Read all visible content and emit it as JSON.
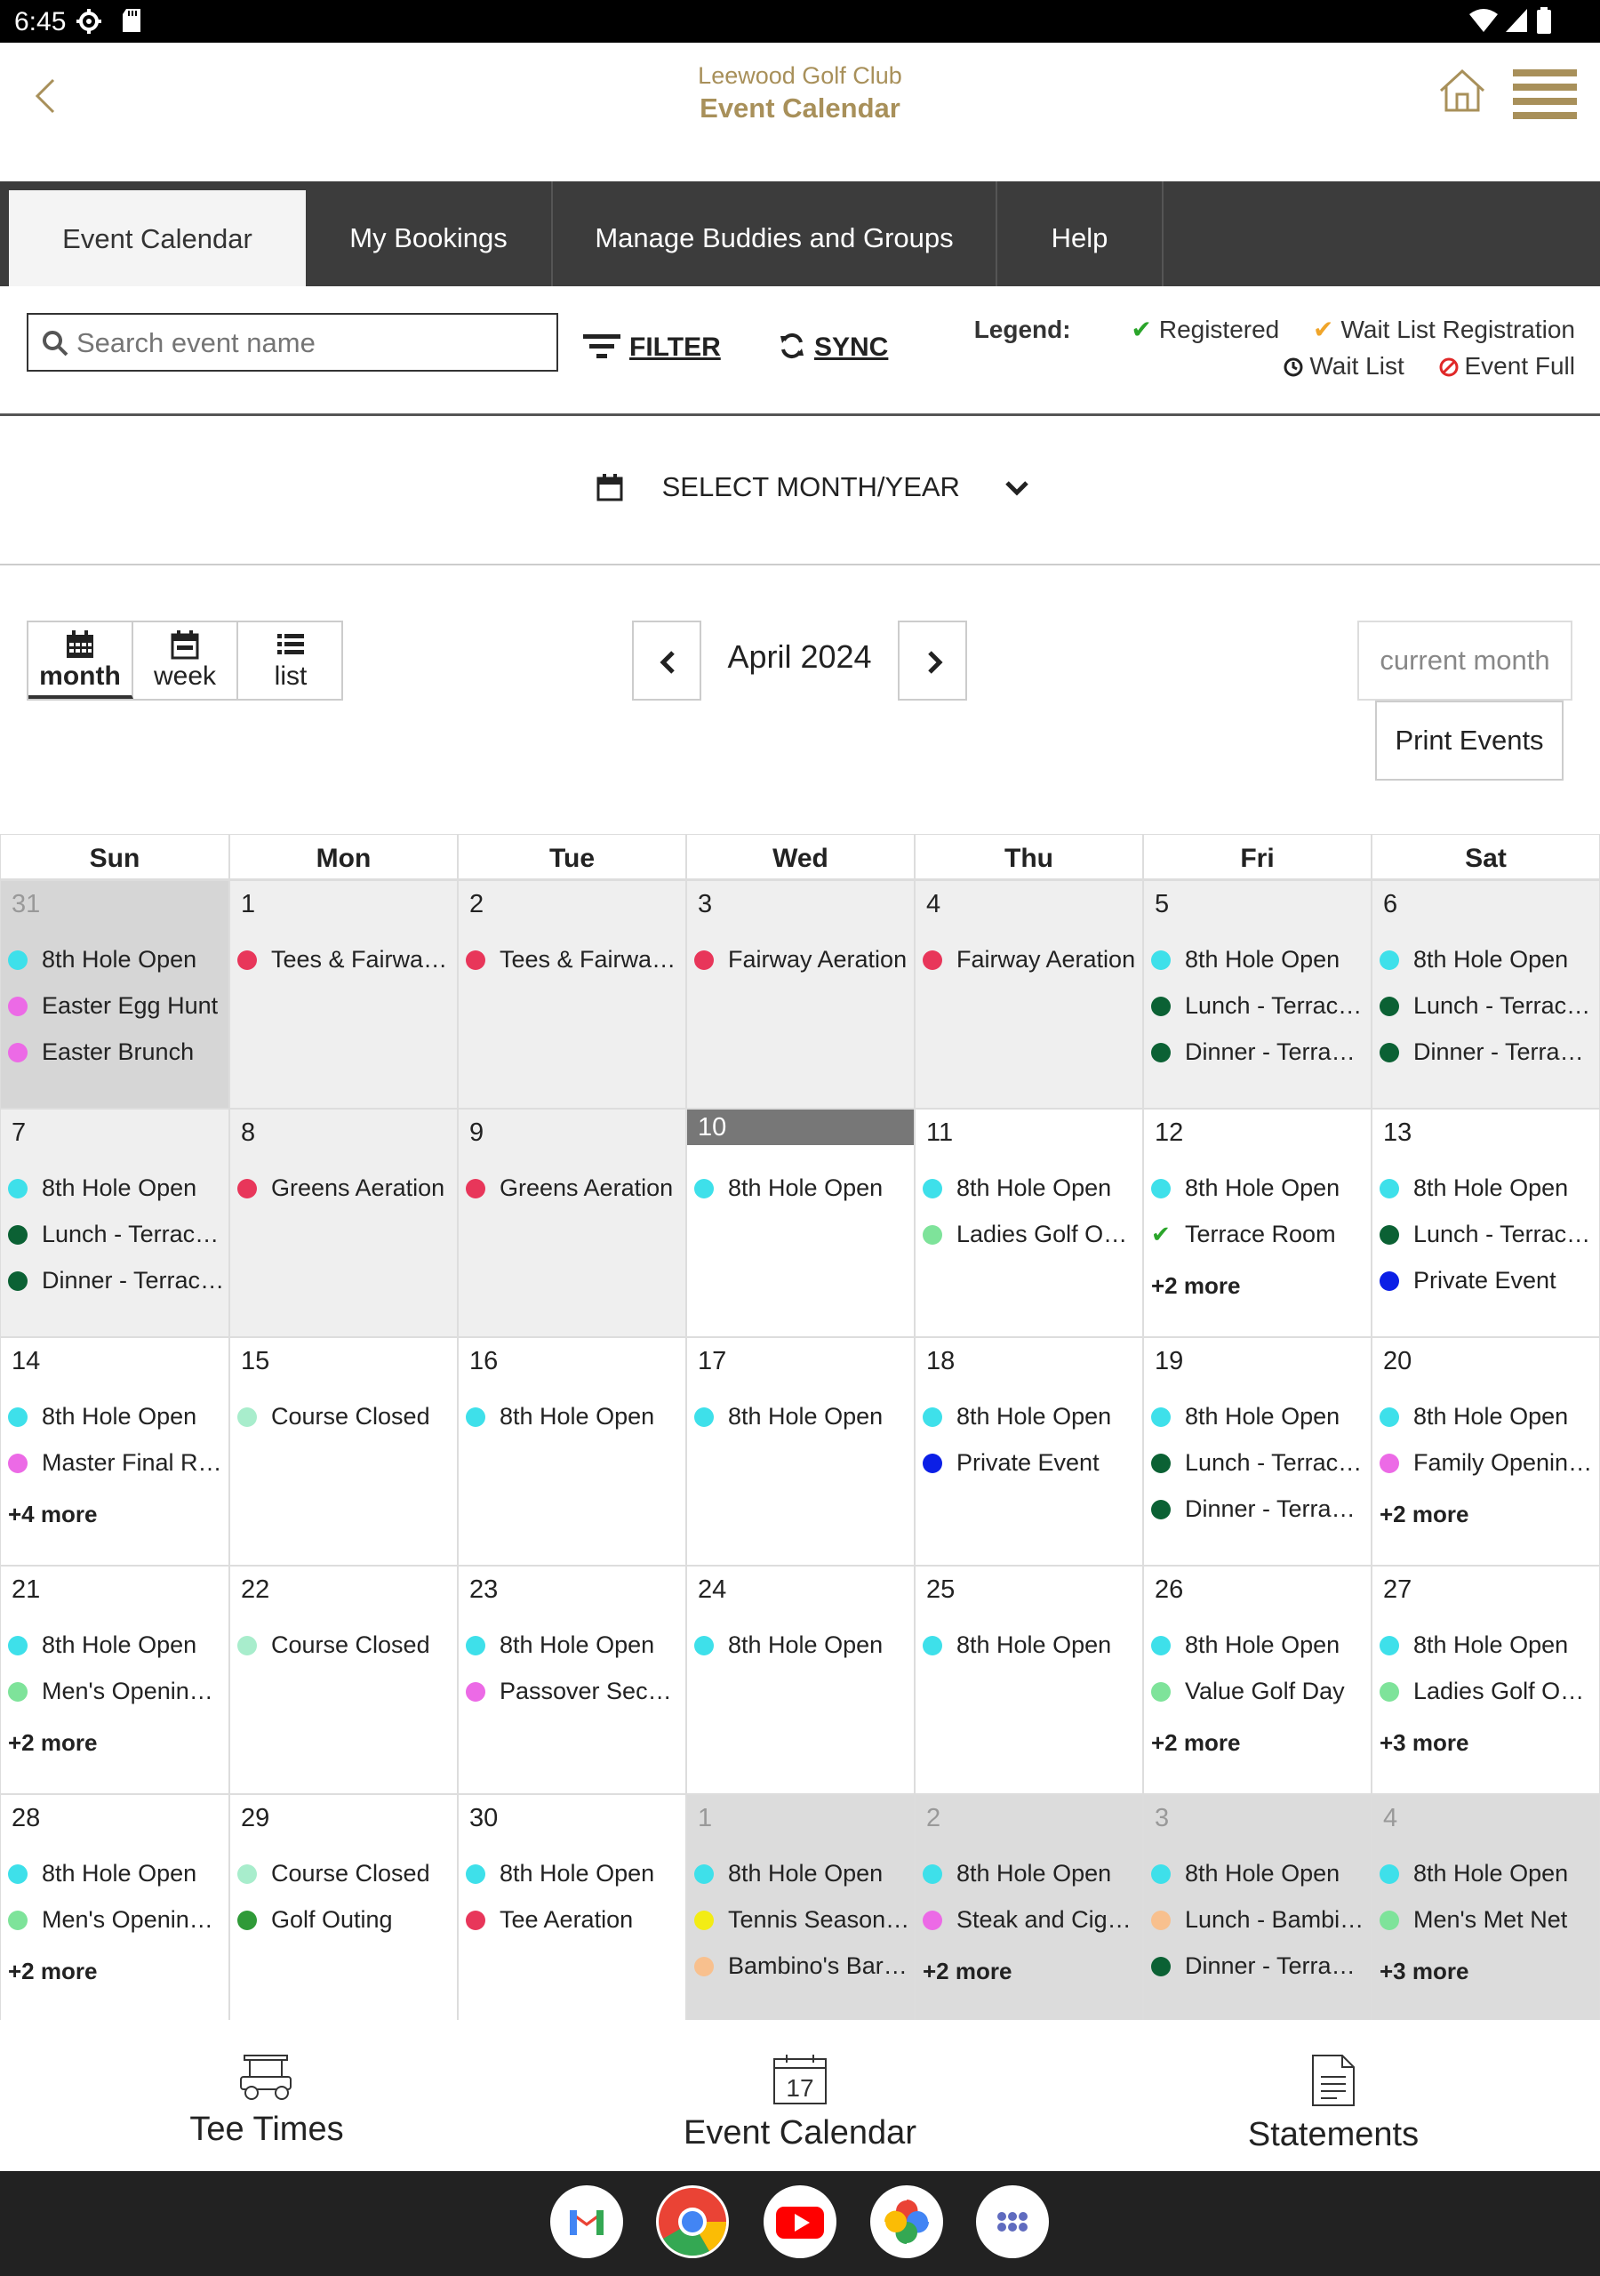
{
  "status_bar": {
    "time": "6:45"
  },
  "header": {
    "club_name": "Leewood Golf Club",
    "title": "Event Calendar"
  },
  "tabs": [
    {
      "label": "Event Calendar",
      "active": true
    },
    {
      "label": "My Bookings"
    },
    {
      "label": "Manage Buddies and Groups"
    },
    {
      "label": "Help"
    }
  ],
  "toolbar": {
    "search_placeholder": "Search event name",
    "filter_label": "FILTER",
    "sync_label": "SYNC",
    "legend_label": "Legend:",
    "legend": {
      "registered": "Registered",
      "wait_list_registration": "Wait List Registration",
      "wait_list": "Wait List",
      "event_full": "Event Full"
    }
  },
  "month_select": {
    "label": "SELECT MONTH/YEAR"
  },
  "views": [
    {
      "label": "month",
      "active": true
    },
    {
      "label": "week"
    },
    {
      "label": "list"
    }
  ],
  "nav": {
    "title": "April 2024",
    "current_month_label": "current month",
    "print_label": "Print Events"
  },
  "colors": {
    "cyan": "#3ee0ea",
    "magenta": "#ec6ae6",
    "red": "#e8365a",
    "darkgreen": "#0b6134",
    "lightgreen": "#7ee39a",
    "blue": "#0b1fe6",
    "mint": "#a8edcc",
    "green": "#2f9a38",
    "yellow": "#f3ec14",
    "peach": "#f8c08e",
    "gold": "#a8905a",
    "check_green": "#2aa52a",
    "check_orange": "#f0a52a",
    "full_red": "#e02828"
  },
  "calendar": {
    "days_of_week": [
      "Sun",
      "Mon",
      "Tue",
      "Wed",
      "Thu",
      "Fri",
      "Sat"
    ],
    "weeks": [
      [
        {
          "num": "31",
          "state": "other",
          "events": [
            {
              "label": "8th Hole Open",
              "color": "cyan"
            },
            {
              "label": "Easter Egg Hunt",
              "color": "magenta"
            },
            {
              "label": "Easter Brunch",
              "color": "magenta"
            }
          ]
        },
        {
          "num": "1",
          "state": "past",
          "events": [
            {
              "label": "Tees & Fairways Aeration",
              "color": "red"
            }
          ]
        },
        {
          "num": "2",
          "state": "past",
          "events": [
            {
              "label": "Tees & Fairways Aeration",
              "color": "red"
            }
          ]
        },
        {
          "num": "3",
          "state": "past",
          "events": [
            {
              "label": "Fairway Aeration",
              "color": "red"
            }
          ]
        },
        {
          "num": "4",
          "state": "past",
          "events": [
            {
              "label": "Fairway Aeration",
              "color": "red"
            }
          ]
        },
        {
          "num": "5",
          "state": "past",
          "events": [
            {
              "label": "8th Hole Open",
              "color": "cyan"
            },
            {
              "label": "Lunch - Terrace Room",
              "color": "darkgreen"
            },
            {
              "label": "Dinner - Terrace Room",
              "color": "darkgreen"
            }
          ]
        },
        {
          "num": "6",
          "state": "past",
          "events": [
            {
              "label": "8th Hole Open",
              "color": "cyan"
            },
            {
              "label": "Lunch - Terrace Room",
              "color": "darkgreen"
            },
            {
              "label": "Dinner - Terrace Room",
              "color": "darkgreen"
            }
          ]
        }
      ],
      [
        {
          "num": "7",
          "state": "past",
          "events": [
            {
              "label": "8th Hole Open",
              "color": "cyan"
            },
            {
              "label": "Lunch - Terrace Room",
              "color": "darkgreen"
            },
            {
              "label": "Dinner - Terrace Room",
              "color": "darkgreen"
            }
          ]
        },
        {
          "num": "8",
          "state": "past",
          "events": [
            {
              "label": "Greens Aeration",
              "color": "red"
            }
          ]
        },
        {
          "num": "9",
          "state": "past",
          "events": [
            {
              "label": "Greens Aeration",
              "color": "red"
            }
          ]
        },
        {
          "num": "10",
          "state": "today",
          "events": [
            {
              "label": "8th Hole Open",
              "color": "cyan"
            }
          ]
        },
        {
          "num": "11",
          "state": "current",
          "events": [
            {
              "label": "8th Hole Open",
              "color": "cyan"
            },
            {
              "label": "Ladies Golf Opening Day",
              "color": "lightgreen"
            }
          ]
        },
        {
          "num": "12",
          "state": "current",
          "events": [
            {
              "label": "8th Hole Open",
              "color": "cyan"
            },
            {
              "label": "Terrace Room",
              "registered": true
            }
          ],
          "more": "+2 more"
        },
        {
          "num": "13",
          "state": "current",
          "events": [
            {
              "label": "8th Hole Open",
              "color": "cyan"
            },
            {
              "label": "Lunch - Terrace Room",
              "color": "darkgreen"
            },
            {
              "label": "Private Event",
              "color": "blue"
            }
          ]
        }
      ],
      [
        {
          "num": "14",
          "state": "current",
          "events": [
            {
              "label": "8th Hole Open",
              "color": "cyan"
            },
            {
              "label": "Master Final Round",
              "color": "magenta"
            }
          ],
          "more": "+4 more"
        },
        {
          "num": "15",
          "state": "current",
          "events": [
            {
              "label": "Course Closed",
              "color": "mint"
            }
          ]
        },
        {
          "num": "16",
          "state": "current",
          "events": [
            {
              "label": "8th Hole Open",
              "color": "cyan"
            }
          ]
        },
        {
          "num": "17",
          "state": "current",
          "events": [
            {
              "label": "8th Hole Open",
              "color": "cyan"
            }
          ]
        },
        {
          "num": "18",
          "state": "current",
          "events": [
            {
              "label": "8th Hole Open",
              "color": "cyan"
            },
            {
              "label": "Private Event",
              "color": "blue"
            }
          ]
        },
        {
          "num": "19",
          "state": "current",
          "events": [
            {
              "label": "8th Hole Open",
              "color": "cyan"
            },
            {
              "label": "Lunch - Terrace Room",
              "color": "darkgreen"
            },
            {
              "label": "Dinner - Terrace Room",
              "color": "darkgreen"
            }
          ]
        },
        {
          "num": "20",
          "state": "current",
          "events": [
            {
              "label": "8th Hole Open",
              "color": "cyan"
            },
            {
              "label": "Family Opening Day",
              "color": "magenta"
            }
          ],
          "more": "+2 more"
        }
      ],
      [
        {
          "num": "21",
          "state": "current",
          "events": [
            {
              "label": "8th Hole Open",
              "color": "cyan"
            },
            {
              "label": "Men's Opening Day",
              "color": "lightgreen"
            }
          ],
          "more": "+2 more"
        },
        {
          "num": "22",
          "state": "current",
          "events": [
            {
              "label": "Course Closed",
              "color": "mint"
            }
          ]
        },
        {
          "num": "23",
          "state": "current",
          "events": [
            {
              "label": "8th Hole Open",
              "color": "cyan"
            },
            {
              "label": "Passover Seconds",
              "color": "magenta"
            }
          ]
        },
        {
          "num": "24",
          "state": "current",
          "events": [
            {
              "label": "8th Hole Open",
              "color": "cyan"
            }
          ]
        },
        {
          "num": "25",
          "state": "current",
          "events": [
            {
              "label": "8th Hole Open",
              "color": "cyan"
            }
          ]
        },
        {
          "num": "26",
          "state": "current",
          "events": [
            {
              "label": "8th Hole Open",
              "color": "cyan"
            },
            {
              "label": "Value Golf Day",
              "color": "lightgreen"
            }
          ],
          "more": "+2 more"
        },
        {
          "num": "27",
          "state": "current",
          "events": [
            {
              "label": "8th Hole Open",
              "color": "cyan"
            },
            {
              "label": "Ladies Golf Opening",
              "color": "lightgreen"
            }
          ],
          "more": "+3 more"
        }
      ],
      [
        {
          "num": "28",
          "state": "current",
          "events": [
            {
              "label": "8th Hole Open",
              "color": "cyan"
            },
            {
              "label": "Men's Opening Day",
              "color": "lightgreen"
            }
          ],
          "more": "+2 more"
        },
        {
          "num": "29",
          "state": "current",
          "events": [
            {
              "label": "Course Closed",
              "color": "mint"
            },
            {
              "label": "Golf Outing",
              "color": "green"
            }
          ]
        },
        {
          "num": "30",
          "state": "current",
          "events": [
            {
              "label": "8th Hole Open",
              "color": "cyan"
            },
            {
              "label": "Tee Aeration",
              "color": "red"
            }
          ]
        },
        {
          "num": "1",
          "state": "other",
          "events": [
            {
              "label": "8th Hole Open",
              "color": "cyan"
            },
            {
              "label": "Tennis Season Opening",
              "color": "yellow"
            },
            {
              "label": "Bambino's Bar Night",
              "color": "peach"
            }
          ]
        },
        {
          "num": "2",
          "state": "other",
          "events": [
            {
              "label": "8th Hole Open",
              "color": "cyan"
            },
            {
              "label": "Steak and Cigar Night",
              "color": "magenta"
            }
          ],
          "more": "+2 more"
        },
        {
          "num": "3",
          "state": "other",
          "events": [
            {
              "label": "8th Hole Open",
              "color": "cyan"
            },
            {
              "label": "Lunch - Bambino's",
              "color": "peach"
            },
            {
              "label": "Dinner - Terrace Room",
              "color": "darkgreen"
            }
          ]
        },
        {
          "num": "4",
          "state": "other",
          "events": [
            {
              "label": "8th Hole Open",
              "color": "cyan"
            },
            {
              "label": "Men's Met Net",
              "color": "lightgreen"
            }
          ],
          "more": "+3 more"
        }
      ]
    ]
  },
  "bottom_nav": [
    {
      "label": "Tee Times",
      "icon": "golf-cart-icon"
    },
    {
      "label": "Event Calendar",
      "icon": "calendar-17-icon",
      "calendar_day": "17"
    },
    {
      "label": "Statements",
      "icon": "document-icon"
    }
  ],
  "dock_apps": [
    "gmail-icon",
    "chrome-icon",
    "youtube-icon",
    "photos-icon",
    "apps-grid-icon"
  ]
}
